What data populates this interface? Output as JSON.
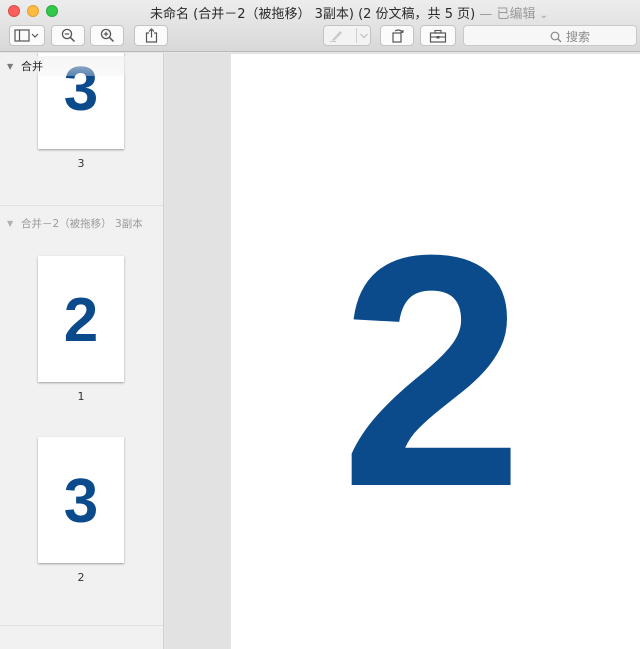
{
  "window": {
    "title": "未命名 (合并－2（被拖移） 3副本) (2 份文稿，共 5 页)",
    "edited_label": "— 已编辑",
    "edited_chevron": "⌄"
  },
  "toolbar": {
    "search_placeholder": "搜索"
  },
  "sidebar": {
    "groups": [
      {
        "name": "合并",
        "pages": [
          {
            "digit": "3",
            "label": "3"
          }
        ]
      },
      {
        "name": "合并－2（被拖移） 3副本",
        "pages": [
          {
            "digit": "2",
            "label": "1"
          },
          {
            "digit": "3",
            "label": "2"
          }
        ]
      }
    ]
  },
  "document": {
    "page_digit": "2"
  },
  "colors": {
    "digit_blue": "#0b4a8b",
    "close": "#fc605c",
    "minimize": "#fdbc40",
    "maximize": "#34c84a"
  }
}
